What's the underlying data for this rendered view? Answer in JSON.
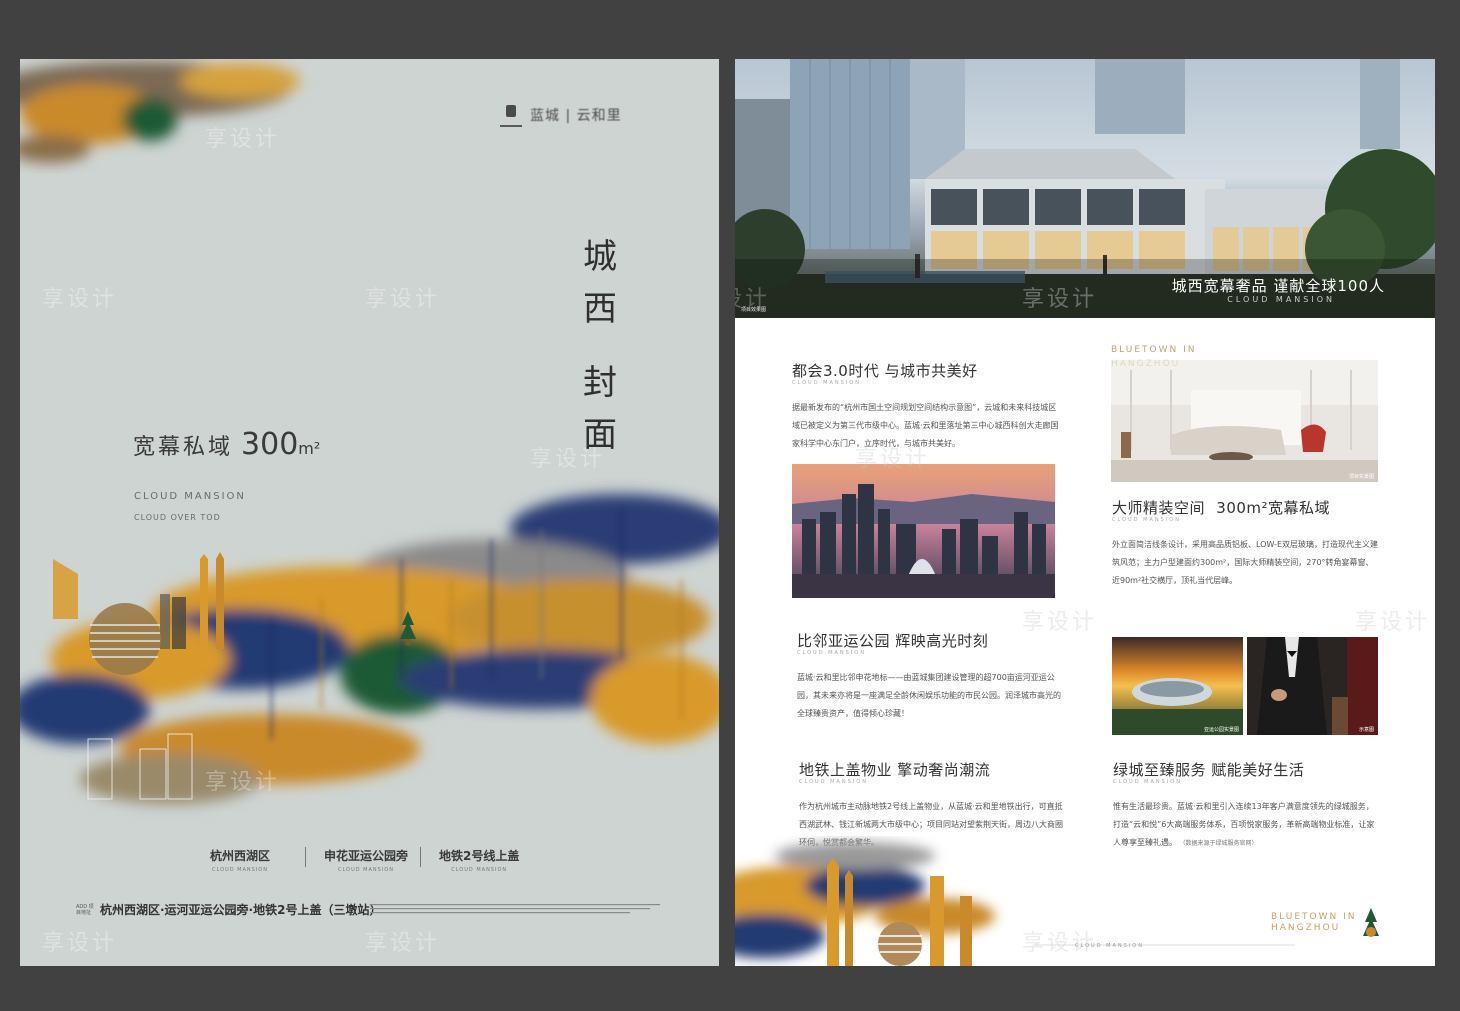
{
  "left_poster": {
    "logo_text": "蓝城 | 云和里",
    "vertical_title_line1": [
      "城",
      "西"
    ],
    "vertical_title_line2": [
      "封",
      "面"
    ],
    "headline_zh": "宽幕私域",
    "headline_num": "300",
    "headline_unit": "m²",
    "subtitle_en_1": "CLOUD MANSION",
    "subtitle_en_2": "CLOUD OVER TOD",
    "features": [
      {
        "label": "杭州西湖区",
        "en": "CLOUD MANSION"
      },
      {
        "label": "申花亚运公园旁",
        "en": "CLOUD MANSION"
      },
      {
        "label": "地铁2号线上盖",
        "en": "CLOUD MANSION"
      }
    ],
    "address_tag": "ADD 项目地址",
    "address": "杭州西湖区·运河亚运公园旁·地铁2号上盖（三墩站）"
  },
  "right_poster": {
    "hero_caption": "城西宽幕奢品 谨献全球100人",
    "hero_caption_en": "CLOUD MANSION",
    "hero_note": "项目效果图",
    "brand_en_top": [
      "BLUETOWN IN",
      "HANGZHOU"
    ],
    "sections": [
      {
        "title": "都会3.0时代 与城市共美好",
        "en": "CLOUD MANSION",
        "body": "据最新发布的“杭州市国土空间规划空间结构示意图”，云城和未来科技城区域已被定义为第三代市级中心。蓝城·云和里落址第三中心城西科创大走廊国家科学中心东门户，立序时代，与城市共美好。"
      },
      {
        "title": "大师精装空间",
        "title_num": "300m²宽幕私域",
        "en": "CLOUD MANSION",
        "body": "外立面简洁线条设计，采用高品质铝板、LOW-E双层玻璃，打造现代主义建筑风范；主力户型建面约300m²，国际大师精装空间，270°转角宴幕窗、近90m²社交横厅，顶礼当代层峰。"
      },
      {
        "title": "比邻亚运公园 辉映高光时刻",
        "en": "CLOUD MANSION",
        "body": "蓝城·云和里比邻申花地标——由蓝城集团建设管理的超700亩运河亚运公园，其未来亦将是一座满足全龄休闲娱乐功能的市民公园。润泽城市高光的全球臻贵资产，值得倾心珍藏！"
      },
      {
        "title": "地铁上盖物业 擎动奢尚潮流",
        "en": "CLOUD MANSION",
        "body": "作为杭州城市主动脉地铁2号线上盖物业，从蓝城·云和里地铁出行，可直抵西湖武林、钱江新城两大市级中心；项目同站对望紫荆天街，周边八大商圈环伺，悦赏都会繁华。"
      },
      {
        "title": "绿城至臻服务 赋能美好生活",
        "en": "CLOUD MANSION",
        "body": "惟有生活最珍贵。蓝城·云和里引入连续13年客户满意度领先的绿城服务，打造“云和悦”6大高端服务体系，百项悦家服务，革新高端物业标准，让家人尊享至臻礼遇。",
        "note": "（数据来源于绿城服务官网）"
      }
    ],
    "photo_caps": [
      "项目实景图",
      "亚运公园实景图",
      "示意图"
    ],
    "footer_brand_en": [
      "BLUETOWN IN",
      "HANGZHOU"
    ],
    "footer_cloud_en": "CLOUD MANSION"
  },
  "watermark": "享设计",
  "colors": {
    "background": "#414141",
    "left_bg": "#ced4d2",
    "gold": "#d89a2c",
    "navy": "#233a72",
    "green": "#1f5a36",
    "accent_gold": "#c8a266"
  }
}
